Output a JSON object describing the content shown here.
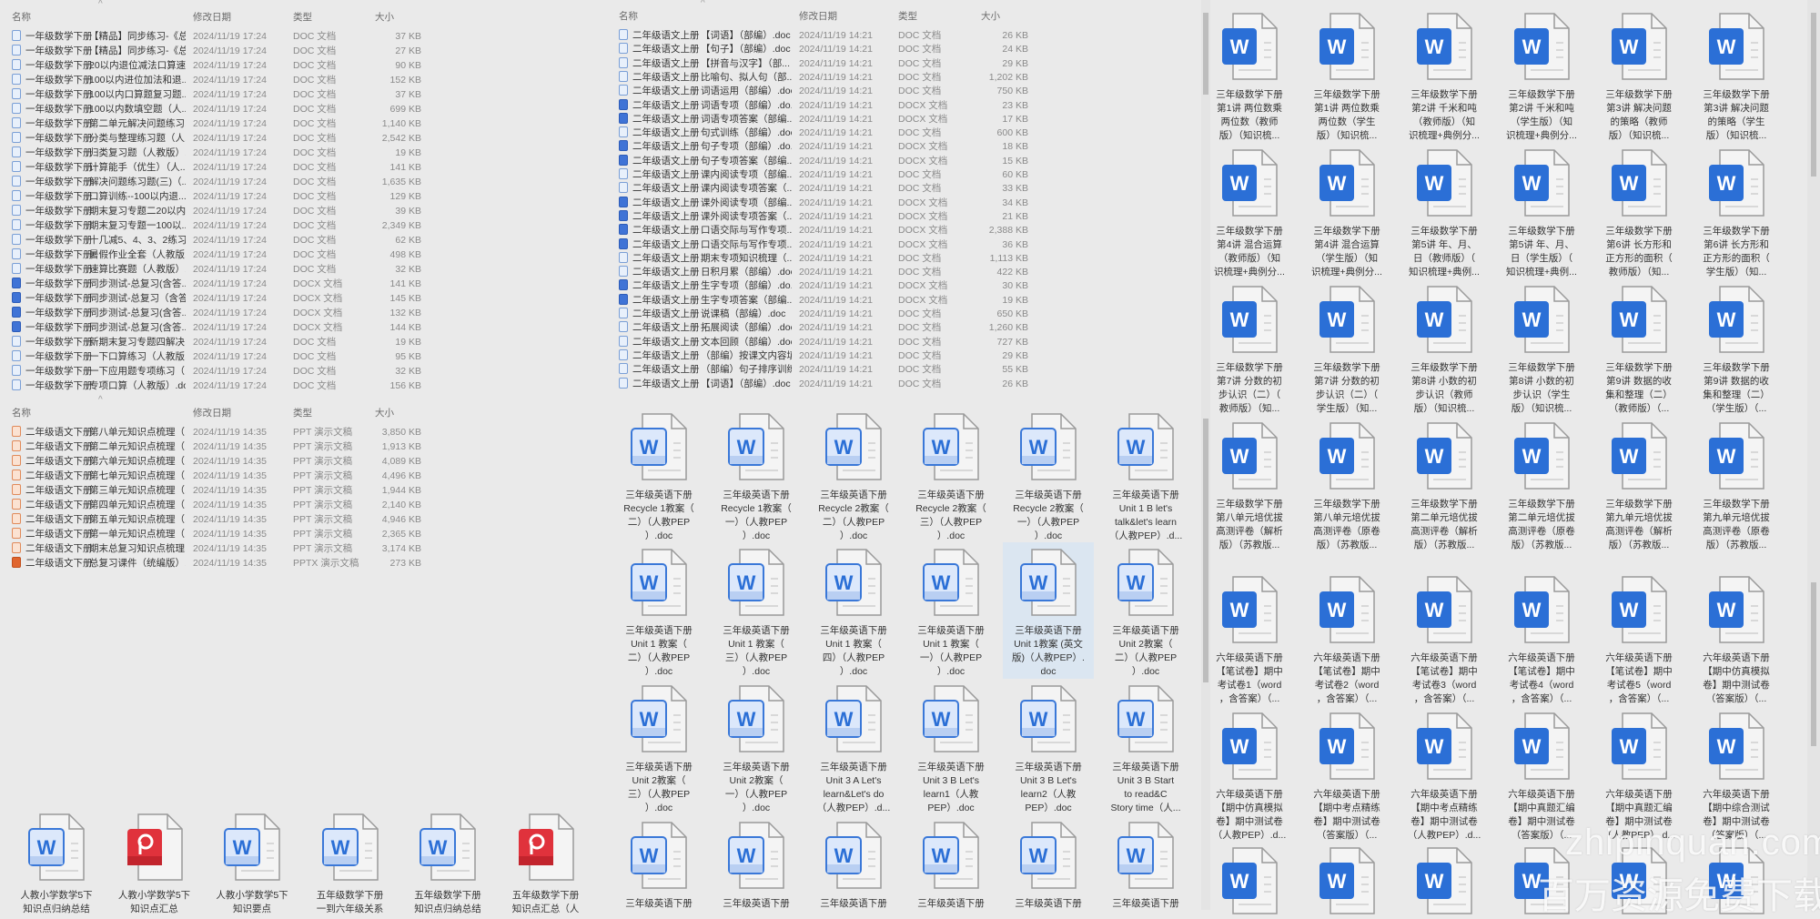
{
  "columns": {
    "name": "名称",
    "date": "修改日期",
    "type": "类型",
    "size": "大小",
    "sort_indicator": "^"
  },
  "list_math1": {
    "prefix": "一年级数学下册",
    "date": "2024/11/19 17:24",
    "rows": [
      {
        "name": "【精品】同步练习-《总...",
        "type": "DOC 文档",
        "size": "37 KB",
        "icon": "doc"
      },
      {
        "name": "【精品】同步练习-《总...",
        "type": "DOC 文档",
        "size": "27 KB",
        "icon": "doc"
      },
      {
        "name": "20以内退位减法口算速...",
        "type": "DOC 文档",
        "size": "90 KB",
        "icon": "doc"
      },
      {
        "name": "100以内进位加法和退...",
        "type": "DOC 文档",
        "size": "152 KB",
        "icon": "doc"
      },
      {
        "name": "100以内口算题复习题...",
        "type": "DOC 文档",
        "size": "37 KB",
        "icon": "doc"
      },
      {
        "name": "100以内数填空题（人...",
        "type": "DOC 文档",
        "size": "699 KB",
        "icon": "doc"
      },
      {
        "name": "第二单元解决问题练习...",
        "type": "DOC 文档",
        "size": "1,140 KB",
        "icon": "doc"
      },
      {
        "name": "分类与整理练习题（人...",
        "type": "DOC 文档",
        "size": "2,542 KB",
        "icon": "doc"
      },
      {
        "name": "归类复习题（人教版）....",
        "type": "DOC 文档",
        "size": "19 KB",
        "icon": "doc"
      },
      {
        "name": "计算能手（优生）（人...",
        "type": "DOC 文档",
        "size": "141 KB",
        "icon": "doc"
      },
      {
        "name": "解决问题练习题(三)（...",
        "type": "DOC 文档",
        "size": "1,635 KB",
        "icon": "doc"
      },
      {
        "name": "口算训练--100以内退...",
        "type": "DOC 文档",
        "size": "129 KB",
        "icon": "doc"
      },
      {
        "name": "期末复习专题二20以内...",
        "type": "DOC 文档",
        "size": "39 KB",
        "icon": "doc"
      },
      {
        "name": "期末复习专题一100以...",
        "type": "DOC 文档",
        "size": "2,349 KB",
        "icon": "doc"
      },
      {
        "name": "十几减5、4、3、2练习...",
        "type": "DOC 文档",
        "size": "62 KB",
        "icon": "doc"
      },
      {
        "name": "暑假作业全套（人教版...",
        "type": "DOC 文档",
        "size": "498 KB",
        "icon": "doc"
      },
      {
        "name": "速算比赛题（人教版）....",
        "type": "DOC 文档",
        "size": "32 KB",
        "icon": "doc"
      },
      {
        "name": "同步测试-总复习(含答...",
        "type": "DOCX 文档",
        "size": "141 KB",
        "icon": "docx"
      },
      {
        "name": "同步测试-总复习（含答...",
        "type": "DOCX 文档",
        "size": "145 KB",
        "icon": "docx"
      },
      {
        "name": "同步测试-总复习(含答...",
        "type": "DOCX 文档",
        "size": "132 KB",
        "icon": "docx"
      },
      {
        "name": "同步测试-总复习(含答...",
        "type": "DOCX 文档",
        "size": "144 KB",
        "icon": "docx"
      },
      {
        "name": "新期末复习专题四解决...",
        "type": "DOC 文档",
        "size": "19 KB",
        "icon": "doc"
      },
      {
        "name": "一下口算练习（人教版...",
        "type": "DOC 文档",
        "size": "95 KB",
        "icon": "doc"
      },
      {
        "name": "一下应用题专项练习（...",
        "type": "DOC 文档",
        "size": "32 KB",
        "icon": "doc"
      },
      {
        "name": "专项口算（人教版）.doc",
        "type": "DOC 文档",
        "size": "156 KB",
        "icon": "doc"
      }
    ]
  },
  "list_chinese_lower": {
    "prefix": "二年级语文下册",
    "date": "2024/11/19 14:35",
    "rows": [
      {
        "name": "第八单元知识点梳理（...",
        "type": "PPT 演示文稿",
        "size": "3,850 KB",
        "icon": "ppt"
      },
      {
        "name": "第二单元知识点梳理（...",
        "type": "PPT 演示文稿",
        "size": "1,913 KB",
        "icon": "ppt"
      },
      {
        "name": "第六单元知识点梳理（...",
        "type": "PPT 演示文稿",
        "size": "4,089 KB",
        "icon": "ppt"
      },
      {
        "name": "第七单元知识点梳理（...",
        "type": "PPT 演示文稿",
        "size": "4,496 KB",
        "icon": "ppt"
      },
      {
        "name": "第三单元知识点梳理（...",
        "type": "PPT 演示文稿",
        "size": "1,944 KB",
        "icon": "ppt"
      },
      {
        "name": "第四单元知识点梳理（...",
        "type": "PPT 演示文稿",
        "size": "2,140 KB",
        "icon": "ppt"
      },
      {
        "name": "第五单元知识点梳理（...",
        "type": "PPT 演示文稿",
        "size": "4,946 KB",
        "icon": "ppt"
      },
      {
        "name": "第一单元知识点梳理（...",
        "type": "PPT 演示文稿",
        "size": "2,365 KB",
        "icon": "ppt"
      },
      {
        "name": "期末总复习知识点梳理...",
        "type": "PPT 演示文稿",
        "size": "3,174 KB",
        "icon": "ppt"
      },
      {
        "name": "总复习课件（统编版）....",
        "type": "PPTX 演示文稿",
        "size": "273 KB",
        "icon": "pptx"
      }
    ]
  },
  "list_chinese_upper": {
    "prefix": "二年级语文上册",
    "date": "2024/11/19 14:21",
    "rows": [
      {
        "name": "【词语】（部编）.doc",
        "type": "DOC 文档",
        "size": "26 KB",
        "icon": "doc"
      },
      {
        "name": "【句子】（部编）.doc",
        "type": "DOC 文档",
        "size": "24 KB",
        "icon": "doc"
      },
      {
        "name": "【拼音与汉字】（部...",
        "type": "DOC 文档",
        "size": "29 KB",
        "icon": "doc"
      },
      {
        "name": "比喻句、拟人句（部...",
        "type": "DOC 文档",
        "size": "1,202 KB",
        "icon": "doc"
      },
      {
        "name": "词语运用（部编）.doc",
        "type": "DOC 文档",
        "size": "750 KB",
        "icon": "doc"
      },
      {
        "name": "词语专项（部编）.do...",
        "type": "DOCX 文档",
        "size": "23 KB",
        "icon": "docx"
      },
      {
        "name": "词语专项答案（部编...",
        "type": "DOCX 文档",
        "size": "17 KB",
        "icon": "docx"
      },
      {
        "name": "句式训练（部编）.doc",
        "type": "DOC 文档",
        "size": "600 KB",
        "icon": "doc"
      },
      {
        "name": "句子专项（部编）.do...",
        "type": "DOCX 文档",
        "size": "18 KB",
        "icon": "docx"
      },
      {
        "name": "句子专项答案（部编...",
        "type": "DOCX 文档",
        "size": "15 KB",
        "icon": "docx"
      },
      {
        "name": "课内阅读专项（部编...",
        "type": "DOC 文档",
        "size": "60 KB",
        "icon": "doc"
      },
      {
        "name": "课内阅读专项答案（...",
        "type": "DOC 文档",
        "size": "33 KB",
        "icon": "doc"
      },
      {
        "name": "课外阅读专项（部编...",
        "type": "DOCX 文档",
        "size": "34 KB",
        "icon": "docx"
      },
      {
        "name": "课外阅读专项答案（...",
        "type": "DOCX 文档",
        "size": "21 KB",
        "icon": "docx"
      },
      {
        "name": "口语交际与写作专项...",
        "type": "DOCX 文档",
        "size": "2,388 KB",
        "icon": "docx"
      },
      {
        "name": "口语交际与写作专项...",
        "type": "DOCX 文档",
        "size": "36 KB",
        "icon": "docx"
      },
      {
        "name": "期末专项知识梳理（...",
        "type": "DOC 文档",
        "size": "1,113 KB",
        "icon": "doc"
      },
      {
        "name": "日积月累（部编）.doc",
        "type": "DOC 文档",
        "size": "422 KB",
        "icon": "doc"
      },
      {
        "name": "生字专项（部编）.do...",
        "type": "DOCX 文档",
        "size": "30 KB",
        "icon": "docx"
      },
      {
        "name": "生字专项答案（部编...",
        "type": "DOCX 文档",
        "size": "19 KB",
        "icon": "docx"
      },
      {
        "name": "说课稿（部编）.doc",
        "type": "DOC 文档",
        "size": "650 KB",
        "icon": "doc"
      },
      {
        "name": "拓展阅读（部编）.doc",
        "type": "DOC 文档",
        "size": "1,260 KB",
        "icon": "doc"
      },
      {
        "name": "文本回顾（部编）.doc",
        "type": "DOC 文档",
        "size": "727 KB",
        "icon": "doc"
      },
      {
        "name": "（部编）按课文内容填...",
        "type": "DOC 文档",
        "size": "29 KB",
        "icon": "doc"
      },
      {
        "name": "（部编）句子排序训练...",
        "type": "DOC 文档",
        "size": "55 KB",
        "icon": "doc"
      },
      {
        "name": "【词语】（部编）.doc",
        "type": "DOC 文档",
        "size": "26 KB",
        "icon": "doc"
      }
    ]
  },
  "grid_bottom_left": [
    {
      "label": "人教小学数学5下\n知识点归纳总结",
      "icon": "word"
    },
    {
      "label": "人教小学数学5下\n知识点汇总",
      "icon": "pdf"
    },
    {
      "label": "人教小学数学5下\n知识要点",
      "icon": "word"
    },
    {
      "label": "五年级数学下册\n一到六年级关系",
      "icon": "word"
    },
    {
      "label": "五年级数学下册\n知识点归纳总结",
      "icon": "word"
    },
    {
      "label": "五年级数学下册\n知识点汇总（人",
      "icon": "pdf"
    }
  ],
  "grid_english3": {
    "selected_index": 10,
    "items": [
      {
        "label": "三年级英语下册\nRecycle 1教案（\n二）（人教PEP\n）.doc"
      },
      {
        "label": "三年级英语下册\nRecycle 1教案（\n一）（人教PEP\n）.doc"
      },
      {
        "label": "三年级英语下册\nRecycle 2教案（\n二）（人教PEP\n）.doc"
      },
      {
        "label": "三年级英语下册\nRecycle 2教案（\n三）（人教PEP\n）.doc"
      },
      {
        "label": "三年级英语下册\nRecycle 2教案（\n一）（人教PEP\n）.doc"
      },
      {
        "label": "三年级英语下册\nUnit 1 B let's\ntalk&let's learn\n（人教PEP）.d..."
      },
      {
        "label": "三年级英语下册\nUnit 1 教案（\n二）（人教PEP\n）.doc"
      },
      {
        "label": "三年级英语下册\nUnit 1 教案（\n三）（人教PEP\n）.doc"
      },
      {
        "label": "三年级英语下册\nUnit 1 教案（\n四）（人教PEP\n）.doc"
      },
      {
        "label": "三年级英语下册\nUnit 1 教案（\n一）（人教PEP\n）.doc"
      },
      {
        "label": "三年级英语下册\nUnit 1教案 (英文\n版)（人教PEP）.\ndoc"
      },
      {
        "label": "三年级英语下册\nUnit 2教案（\n二）（人教PEP\n）.doc"
      },
      {
        "label": "三年级英语下册\nUnit 2教案（\n三）（人教PEP\n）.doc"
      },
      {
        "label": "三年级英语下册\nUnit 2教案（\n一）（人教PEP\n）.doc"
      },
      {
        "label": "三年级英语下册\nUnit 3 A Let's\nlearn&Let's do\n（人教PEP）.d..."
      },
      {
        "label": "三年级英语下册\nUnit 3 B Let's\nlearn1（人教\nPEP）.doc"
      },
      {
        "label": "三年级英语下册\nUnit 3 B Let's\nlearn2（人教\nPEP）.doc"
      },
      {
        "label": "三年级英语下册\nUnit 3 B Start\nto read&C\nStory time（人..."
      },
      {
        "label": "三年级英语下册"
      },
      {
        "label": "三年级英语下册"
      },
      {
        "label": "三年级英语下册"
      },
      {
        "label": "三年级英语下册"
      },
      {
        "label": "三年级英语下册"
      },
      {
        "label": "三年级英语下册"
      }
    ]
  },
  "grid_right": {
    "items": [
      {
        "label": "三年级数学下册\n第1讲 两位数乘\n两位数（教师\n版）（知识梳..."
      },
      {
        "label": "三年级数学下册\n第1讲 两位数乘\n两位数（学生\n版）（知识梳..."
      },
      {
        "label": "三年级数学下册\n第2讲 千米和吨\n（教师版）（知\n识梳理+典例分..."
      },
      {
        "label": "三年级数学下册\n第2讲 千米和吨\n（学生版）（知\n识梳理+典例分..."
      },
      {
        "label": "三年级数学下册\n第3讲 解决问题\n的策略（教师\n版）（知识梳..."
      },
      {
        "label": "三年级数学下册\n第3讲 解决问题\n的策略（学生\n版）（知识梳..."
      },
      {
        "label": "三年级数学下册\n第4讲 混合运算\n（教师版）（知\n识梳理+典例分..."
      },
      {
        "label": "三年级数学下册\n第4讲 混合运算\n（学生版）（知\n识梳理+典例分..."
      },
      {
        "label": "三年级数学下册\n第5讲 年、月、\n日（教师版）（\n知识梳理+典例..."
      },
      {
        "label": "三年级数学下册\n第5讲 年、月、\n日（学生版）（\n知识梳理+典例..."
      },
      {
        "label": "三年级数学下册\n第6讲 长方形和\n正方形的面积（\n教师版）（知..."
      },
      {
        "label": "三年级数学下册\n第6讲 长方形和\n正方形的面积（\n学生版）（知..."
      },
      {
        "label": "三年级数学下册\n第7讲 分数的初\n步认识（二）（\n教师版）（知..."
      },
      {
        "label": "三年级数学下册\n第7讲 分数的初\n步认识（二）（\n学生版）（知..."
      },
      {
        "label": "三年级数学下册\n第8讲 小数的初\n步认识（教师\n版）（知识梳..."
      },
      {
        "label": "三年级数学下册\n第8讲 小数的初\n步认识（学生\n版）（知识梳..."
      },
      {
        "label": "三年级数学下册\n第9讲 数据的收\n集和整理（二）\n（教师版）（..."
      },
      {
        "label": "三年级数学下册\n第9讲 数据的收\n集和整理（二）\n（学生版）（..."
      },
      {
        "label": "三年级数学下册\n第八单元培优拔\n高测评卷（解析\n版）（苏教版..."
      },
      {
        "label": "三年级数学下册\n第八单元培优拔\n高测评卷（原卷\n版）（苏教版..."
      },
      {
        "label": "三年级数学下册\n第二单元培优拔\n高测评卷（解析\n版）（苏教版..."
      },
      {
        "label": "三年级数学下册\n第二单元培优拔\n高测评卷（原卷\n版）（苏教版..."
      },
      {
        "label": "三年级数学下册\n第九单元培优拔\n高测评卷（解析\n版）（苏教版..."
      },
      {
        "label": "三年级数学下册\n第九单元培优拔\n高测评卷（原卷\n版）（苏教版..."
      },
      {
        "label": "六年级英语下册\n【笔试卷】期中\n考试卷1（word\n，含答案）（..."
      },
      {
        "label": "六年级英语下册\n【笔试卷】期中\n考试卷2（word\n，含答案）（..."
      },
      {
        "label": "六年级英语下册\n【笔试卷】期中\n考试卷3（word\n，含答案）（..."
      },
      {
        "label": "六年级英语下册\n【笔试卷】期中\n考试卷4（word\n，含答案）（..."
      },
      {
        "label": "六年级英语下册\n【笔试卷】期中\n考试卷5（word\n，含答案）（..."
      },
      {
        "label": "六年级英语下册\n【期中仿真模拟\n卷】期中测试卷\n（答案版）（..."
      },
      {
        "label": "六年级英语下册\n【期中仿真模拟\n卷】期中测试卷\n（人教PEP）.d..."
      },
      {
        "label": "六年级英语下册\n【期中考点精练\n卷】期中测试卷\n（答案版）（..."
      },
      {
        "label": "六年级英语下册\n【期中考点精练\n卷】期中测试卷\n（人教PEP）.d..."
      },
      {
        "label": "六年级英语下册\n【期中真题汇编\n卷】期中测试卷\n（答案版）（..."
      },
      {
        "label": "六年级英语下册\n【期中真题汇编\n卷】期中测试卷\n（人教PEP）.d..."
      },
      {
        "label": "六年级英语下册\n【期中综合测试\n卷】期中测试卷\n（答案版）（..."
      },
      {
        "label": ""
      },
      {
        "label": ""
      },
      {
        "label": ""
      },
      {
        "label": ""
      },
      {
        "label": ""
      },
      {
        "label": ""
      }
    ]
  },
  "watermark": {
    "domain": "zhipinquan.com",
    "slogan": "百万资源免费下载"
  },
  "colors": {
    "word_blue": "#2b6fd6",
    "word_light": "#dce8fb",
    "ppt_red": "#e0323c",
    "selection": "#dbe6f1"
  }
}
